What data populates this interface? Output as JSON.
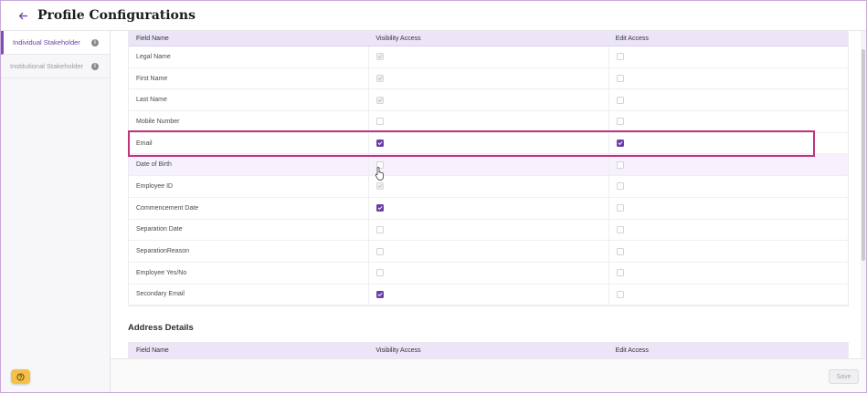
{
  "header": {
    "title": "Profile Configurations"
  },
  "sidebar": {
    "items": [
      {
        "label": "Individual Stakeholder",
        "active": true
      },
      {
        "label": "Institutional Stakeholder",
        "active": false
      }
    ]
  },
  "table": {
    "columns": [
      "Field Name",
      "Visibility Access",
      "Edit Access"
    ],
    "rows": [
      {
        "field": "Legal Name",
        "visibility": "disabled-checked",
        "edit": "unchecked"
      },
      {
        "field": "First Name",
        "visibility": "disabled-checked",
        "edit": "unchecked"
      },
      {
        "field": "Last Name",
        "visibility": "disabled-checked",
        "edit": "unchecked"
      },
      {
        "field": "Mobile Number",
        "visibility": "unchecked",
        "edit": "unchecked"
      },
      {
        "field": "Email",
        "visibility": "checked",
        "edit": "checked"
      },
      {
        "field": "Date of Birth",
        "visibility": "unchecked",
        "edit": "unchecked"
      },
      {
        "field": "Employee ID",
        "visibility": "disabled-checked",
        "edit": "unchecked"
      },
      {
        "field": "Commencement Date",
        "visibility": "checked",
        "edit": "unchecked"
      },
      {
        "field": "Separation Date",
        "visibility": "unchecked",
        "edit": "unchecked"
      },
      {
        "field": "SeparationReason",
        "visibility": "unchecked",
        "edit": "unchecked"
      },
      {
        "field": "Employee Yes/No",
        "visibility": "unchecked",
        "edit": "unchecked"
      },
      {
        "field": "Secondary Email",
        "visibility": "checked",
        "edit": "unchecked"
      }
    ]
  },
  "address_section": {
    "title": "Address Details",
    "columns": [
      "Field Name",
      "Visibility Access",
      "Edit Access"
    ]
  },
  "footer": {
    "save_label": "Save"
  },
  "colors": {
    "accent": "#6b3fa8",
    "header_bg": "#ece4f7",
    "highlight": "#c0337f",
    "help": "#f5c04a"
  }
}
